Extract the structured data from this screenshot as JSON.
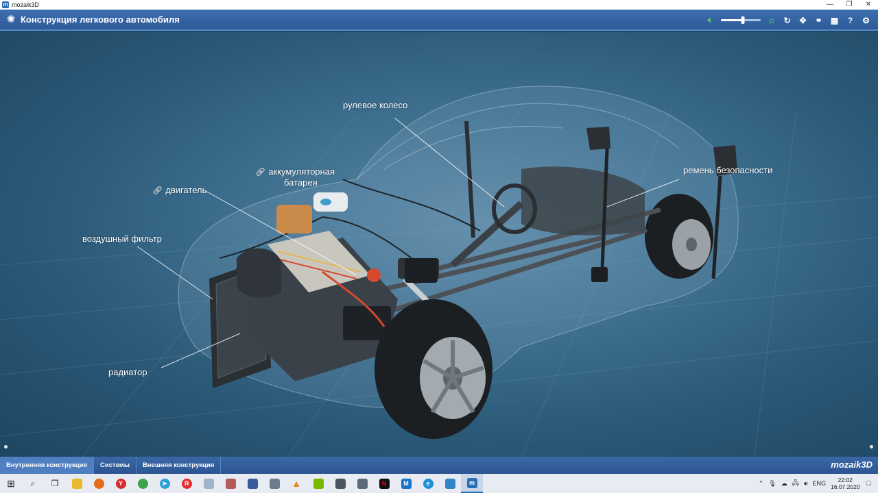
{
  "window": {
    "title": "mozaik3D",
    "controls": [
      "—",
      "❐",
      "✕"
    ]
  },
  "header": {
    "title": "Конструкция легкового автомобиля",
    "volume_level": 0.55,
    "icons": [
      "speaker-icon",
      "music-icon",
      "reset-icon",
      "move-icon",
      "link-icon",
      "grid-icon",
      "help-icon",
      "settings-icon"
    ]
  },
  "labels": {
    "steering_wheel": "рулевое колесо",
    "battery_line1": "аккумуляторная",
    "battery_line2": "батарея",
    "engine": "двигатель",
    "seatbelt": "ремень безопасности",
    "air_filter": "воздушный фильтр",
    "radiator": "радиатор"
  },
  "tabs": [
    {
      "label": "Внутренняя конструкция",
      "active": true
    },
    {
      "label": "Системы",
      "active": false
    },
    {
      "label": "Внешняя конструкция",
      "active": false
    }
  ],
  "brand": "mozaik3D",
  "taskbar": {
    "language": "ENG",
    "time": "22:02",
    "date": "16.07.2020",
    "apps": [
      "start",
      "search",
      "task-view",
      "explorer",
      "firefox",
      "yandex-browser",
      "chrome",
      "telegram",
      "yandex",
      "notepad",
      "archive",
      "writer",
      "disk",
      "vlc",
      "nvidia",
      "calculator",
      "camera",
      "netflix",
      "mail",
      "edge",
      "gallery",
      "mozaik3d"
    ]
  },
  "colors": {
    "header": "#2d5a98",
    "accent": "#5ed36a",
    "scene": "#3e6f8f"
  }
}
